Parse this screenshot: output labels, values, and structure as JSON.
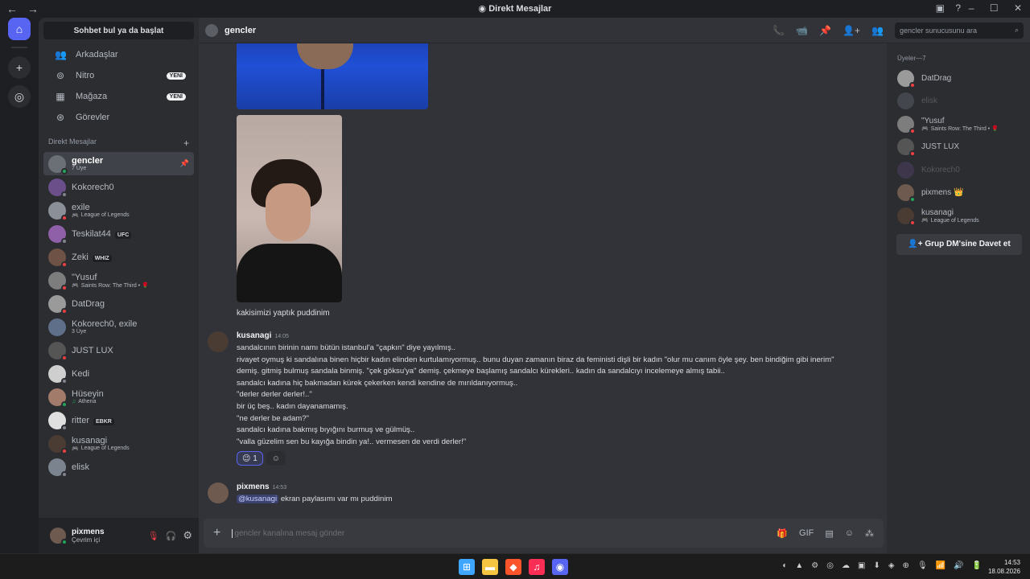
{
  "window": {
    "title": "Direkt Mesajlar",
    "title_icon": "discord-icon",
    "back_icon": "←",
    "forward_icon": "→",
    "inbox_icon": "▣",
    "help_icon": "?",
    "min_icon": "–",
    "max_icon": "☐",
    "close_icon": "✕"
  },
  "guilds": {
    "home_icon": "⌂",
    "add_icon": "+",
    "explore_icon": "◎"
  },
  "sidebar": {
    "search_label": "Sohbet bul ya da başlat",
    "nav": [
      {
        "icon": "👥",
        "label": "Arkadaşlar",
        "badge": ""
      },
      {
        "icon": "⊚",
        "label": "Nitro",
        "badge": "YENİ"
      },
      {
        "icon": "▦",
        "label": "Mağaza",
        "badge": "YENİ"
      },
      {
        "icon": "⊛",
        "label": "Görevler",
        "badge": ""
      }
    ],
    "dm_header": "Direkt Mesajlar",
    "dm_add": "+",
    "dms": [
      {
        "name": "gencler",
        "sub": "7 Üye",
        "game": "",
        "tag": "",
        "status": "on",
        "active": true,
        "avcolor": "#6b6f76"
      },
      {
        "name": "Kokorech0",
        "sub": "",
        "game": "",
        "tag": "",
        "status": "off",
        "active": false,
        "avcolor": "#6a4f8a"
      },
      {
        "name": "exile",
        "sub": "League of Legends",
        "game": "🎮",
        "tag": "",
        "status": "dnd",
        "active": false,
        "avcolor": "#8a8f98"
      },
      {
        "name": "Teskilat44",
        "sub": "",
        "game": "",
        "tag": "UFC",
        "status": "off",
        "active": false,
        "avcolor": "#8f5fa8"
      },
      {
        "name": "Zeki",
        "sub": "",
        "game": "",
        "tag": "WHIZ",
        "status": "dnd",
        "active": false,
        "avcolor": "#6e5246"
      },
      {
        "name": "\"Yusuf",
        "sub": "Saints Row: The Third • 🌹",
        "game": "🎮",
        "tag": "",
        "status": "dnd",
        "active": false,
        "avcolor": "#7d7d7d"
      },
      {
        "name": "DatDrag",
        "sub": "",
        "game": "",
        "tag": "",
        "status": "dnd",
        "active": false,
        "avcolor": "#9a9a9a"
      },
      {
        "name": "Kokorech0, exile",
        "sub": "3 Üye",
        "game": "",
        "tag": "",
        "status": "",
        "active": false,
        "avcolor": "#5f6f8a"
      },
      {
        "name": "JUST LUX",
        "sub": "",
        "game": "",
        "tag": "",
        "status": "dnd",
        "active": false,
        "avcolor": "#555555"
      },
      {
        "name": "Kedi",
        "sub": "",
        "game": "",
        "tag": "",
        "status": "off",
        "active": false,
        "avcolor": "#cfcfcf"
      },
      {
        "name": "Hüseyin",
        "sub": "Athena",
        "game": "♫",
        "tag": "",
        "status": "on",
        "active": false,
        "avcolor": "#a37b6b"
      },
      {
        "name": "ritter",
        "sub": "",
        "game": "",
        "tag": "EBKR",
        "status": "off",
        "active": false,
        "avcolor": "#e0e0e0"
      },
      {
        "name": "kusanagi",
        "sub": "League of Legends",
        "game": "🎮",
        "tag": "",
        "status": "dnd",
        "active": false,
        "avcolor": "#4a3b33"
      },
      {
        "name": "elisk",
        "sub": "",
        "game": "",
        "tag": "",
        "status": "off",
        "active": false,
        "avcolor": "#7b848e"
      }
    ],
    "pin_icon": "📌"
  },
  "userbar": {
    "name": "pixmens",
    "status": "Çevrim içi",
    "mic_icon": "🎙",
    "headset_icon": "🎧",
    "settings_icon": "⚙"
  },
  "header": {
    "channel": "gencler",
    "icons": [
      "📞",
      "📹",
      "📌",
      "👤+",
      "👥"
    ],
    "search_placeholder": "gencler sunucusunu ara",
    "search_icon": "⌕"
  },
  "chat": {
    "image_caption": "kakisimizi yaptık puddinim",
    "message1": {
      "author": "kusanagi",
      "time": "14:05",
      "lines": [
        "sandalcının birinin namı bütün istanbul'a \"çapkın\" diye yayılmış..",
        "rivayet oymuş ki sandalına binen hiçbir kadın elinden kurtulamıyormuş.. bunu duyan zamanın biraz da feministi dişli bir kadın \"olur mu canım öyle şey. ben bindiğim gibi inerim\" demiş. gitmiş bulmuş sandala binmiş. \"çek göksu'ya\" demiş. çekmeye başlamış sandalcı kürekleri.. kadın da sandalcıyı incelemeye almış tabii..",
        "sandalcı kadına hiç bakmadan kürek çekerken kendi kendine de mırıldanıyormuş..",
        "\"derler derler derler!..\"",
        "bir üç beş.. kadın dayanamamış.",
        "\"ne derler be adam?\"",
        "sandalcı kadına bakmış bıyığını burmuş ve gülmüş..",
        "\"valla güzelim sen bu kayığa bindin ya!.. vermesen de verdi derler!\""
      ],
      "reaction_emoji": "😉",
      "reaction_count": "1",
      "add_reaction_icon": "☺"
    },
    "message2": {
      "author": "pixmens",
      "time": "14:53",
      "mention": "@kusanagi",
      "text": " ekran paylasımı var mı puddinim"
    }
  },
  "composer": {
    "plus_icon": "+",
    "placeholder": "gencler kanalına mesaj gönder",
    "icons": [
      "🎁",
      "GIF",
      "▤",
      "☺",
      "⁂"
    ]
  },
  "members": {
    "header": "Üyeler—7",
    "list": [
      {
        "name": "DatDrag",
        "sub": "",
        "game": "",
        "status": "dnd",
        "offline": false,
        "avcolor": "#9a9a9a"
      },
      {
        "name": "elisk",
        "sub": "",
        "game": "",
        "status": "off",
        "offline": true,
        "avcolor": "#7b848e"
      },
      {
        "name": "\"Yusuf",
        "sub": "Saints Row: The Third • 🌹",
        "game": "🎮",
        "status": "dnd",
        "offline": false,
        "avcolor": "#7d7d7d"
      },
      {
        "name": "JUST LUX",
        "sub": "",
        "game": "",
        "status": "dnd",
        "offline": false,
        "avcolor": "#555555"
      },
      {
        "name": "Kokorech0",
        "sub": "",
        "game": "",
        "status": "off",
        "offline": true,
        "avcolor": "#6a4f8a"
      },
      {
        "name": "pixmens 👑",
        "sub": "",
        "game": "",
        "status": "on",
        "offline": false,
        "avcolor": "#6e5a4e"
      },
      {
        "name": "kusanagi",
        "sub": "League of Legends",
        "game": "🎮",
        "status": "dnd",
        "offline": false,
        "avcolor": "#4a3b33"
      }
    ],
    "invite_label": "Grup DM'sine Davet et",
    "invite_icon": "👤+"
  },
  "taskbar": {
    "apps": [
      {
        "icon": "⊞",
        "color": "#3ea6ff"
      },
      {
        "icon": "▬",
        "color": "#f5c542"
      },
      {
        "icon": "◆",
        "color": "#fb542b"
      },
      {
        "icon": "♫",
        "color": "#fa2d55"
      },
      {
        "icon": "◉",
        "color": "#5865f2"
      }
    ],
    "tray": [
      "◐",
      "▲",
      "⚙",
      "◎",
      "☁",
      "▣",
      "⬇",
      "◈",
      "⊕",
      "🎙",
      "📶",
      "🔊",
      "🔋"
    ],
    "time": "14:53",
    "date": "18.08.2026"
  }
}
